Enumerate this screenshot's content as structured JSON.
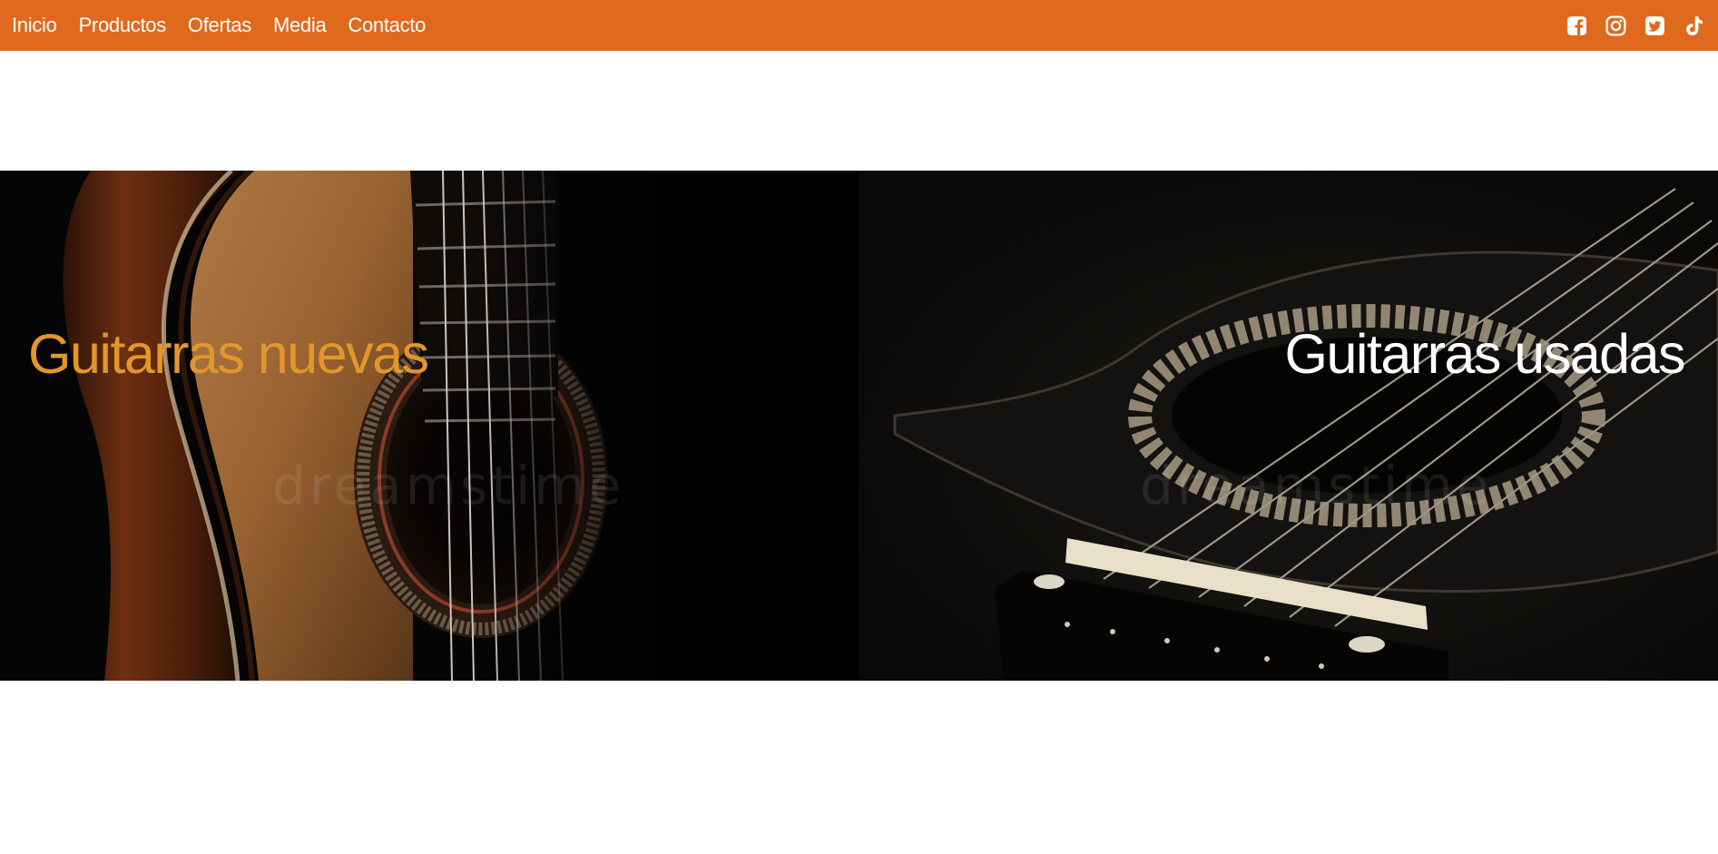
{
  "nav": {
    "links": [
      "Inicio",
      "Productos",
      "Ofertas",
      "Media",
      "Contacto"
    ],
    "social_icons": [
      "facebook-icon",
      "instagram-icon",
      "twitter-icon",
      "tiktok-icon"
    ]
  },
  "hero": {
    "left_title": "Guitarras nuevas",
    "right_title": "Guitarras usadas",
    "watermark": "dreamstime"
  },
  "colors": {
    "nav_bg": "#e0691e",
    "left_title": "#e3962a",
    "right_title": "#ffffff"
  }
}
